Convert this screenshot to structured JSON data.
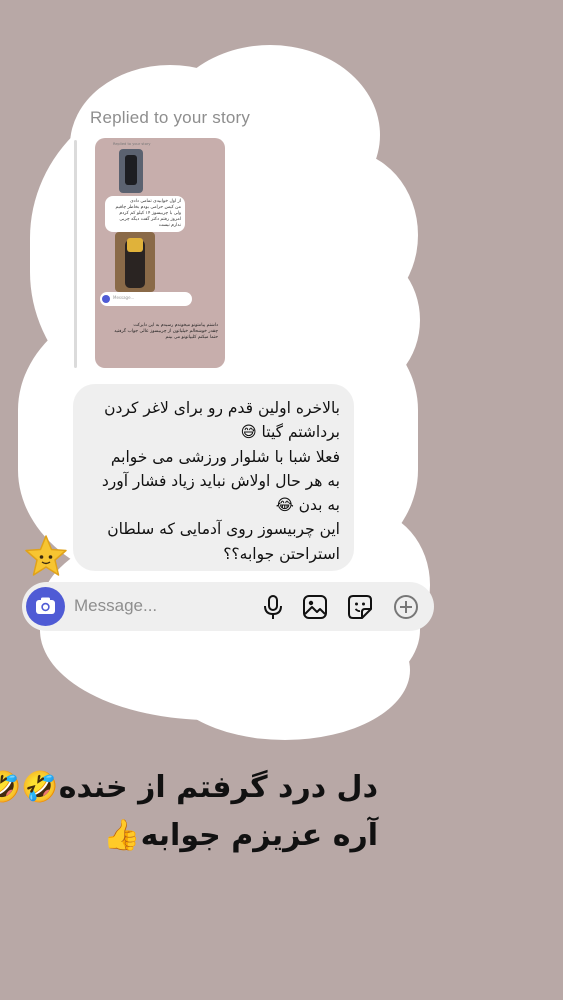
{
  "story_reply": {
    "header": "Replied to your story",
    "thumbnail": {
      "mini_header": "Replied to your story",
      "mini_text_1": "از اول خوابیدی تمامی دادی",
      "mini_text_2": "من کیس حرامی بودم بخاطر چاقیم",
      "mini_text_3": "ولی با چربیسوز ۱۴ کیلو کم کردم",
      "mini_text_4": "امروز رفتم دکتر گفت دیگه چربی",
      "mini_text_5": "ندارم نیست",
      "mini_placeholder": "Message...",
      "mini_footer_1": "داشتم پیامتونو میخوندم رسیدم به این دایرکت",
      "mini_footer_2": "چقدر خوشحالم خیلیاتون از چربیسوز عالی جواب گرفتید",
      "mini_footer_3": "حتما میکنم کلیپاتونو می بینم"
    }
  },
  "message": {
    "lines": [
      "بالاخره اولین قدم  رو برای لاغر کردن",
      "برداشتم گیتا 😅",
      "فعلا شبا با شلوار ورزشی می خوابم",
      "به هر حال اولاش نباید زیاد فشار آورد",
      "به بدن 😂",
      "این چربیسوز روی آدمایی که سلطان",
      "استراحتن جوابه؟؟"
    ],
    "reaction": "star"
  },
  "composer": {
    "placeholder": "Message...",
    "icons": [
      "camera-icon",
      "microphone-icon",
      "gallery-icon",
      "sticker-icon",
      "add-icon"
    ]
  },
  "caption": {
    "line1": "دل درد گرفتم از خنده🤣🤣",
    "line2": "آره عزیزم جوابه👍"
  },
  "colors": {
    "background": "#b8a8a6",
    "bubble": "#efefef",
    "camera_button": "#4f5bd5"
  }
}
